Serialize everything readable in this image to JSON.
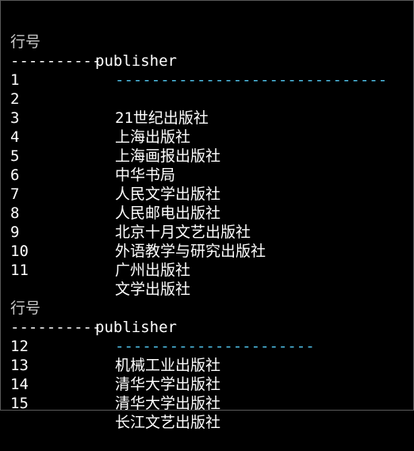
{
  "colors": {
    "background": "#000000",
    "text": "#ffffff",
    "separator_accent": "#4fc1e9"
  },
  "table1": {
    "header": {
      "rownum": "行号",
      "publisher": "publisher"
    },
    "separator": {
      "left": "----------",
      "right": "------------------------------"
    },
    "rows": [
      {
        "num": "1",
        "name": ""
      },
      {
        "num": "2",
        "name": "21世纪出版社"
      },
      {
        "num": "3",
        "name": "上海出版社"
      },
      {
        "num": "4",
        "name": "上海画报出版社"
      },
      {
        "num": "5",
        "name": "中华书局"
      },
      {
        "num": "6",
        "name": "人民文学出版社"
      },
      {
        "num": "7",
        "name": "人民邮电出版社"
      },
      {
        "num": "8",
        "name": "北京十月文艺出版社"
      },
      {
        "num": "9",
        "name": "外语教学与研究出版社"
      },
      {
        "num": "10",
        "name": "广州出版社"
      },
      {
        "num": "11",
        "name": "文学出版社"
      }
    ]
  },
  "table2": {
    "header": {
      "rownum": "行号",
      "publisher": "publisher"
    },
    "separator": {
      "left": "----------",
      "right": "----------------------"
    },
    "rows": [
      {
        "num": "12",
        "name": "机械工业出版社"
      },
      {
        "num": "13",
        "name": "清华大学出版社"
      },
      {
        "num": "14",
        "name": "清华大学出版社"
      },
      {
        "num": "15",
        "name": "长江文艺出版社"
      }
    ]
  }
}
